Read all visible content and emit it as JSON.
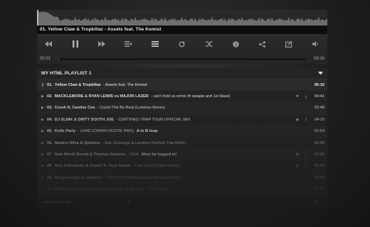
{
  "now_playing": {
    "title": "01. Yellow Claw & Tropkillaz - Assets feat. The Kemist"
  },
  "controls": [
    {
      "name": "rewind-icon"
    },
    {
      "name": "pause-icon"
    },
    {
      "name": "forward-icon"
    },
    {
      "name": "next-track-icon"
    },
    {
      "name": "playlist-icon"
    },
    {
      "name": "repeat-icon"
    },
    {
      "name": "shuffle-icon"
    },
    {
      "name": "info-icon"
    },
    {
      "name": "share-icon"
    },
    {
      "name": "popout-icon"
    },
    {
      "name": "volume-icon"
    }
  ],
  "progress": {
    "current": "00:01",
    "total": "06:16",
    "fraction": 0.003
  },
  "playlist": {
    "name": "MY HTML PLAYLIST 1",
    "tracks": [
      {
        "num": "01.",
        "artist": "Yellow Claw & Tropkillaz",
        "title": "- Assets feat. The Kemist",
        "extra": "",
        "duration": "06:16",
        "active": true,
        "fav": false,
        "dl": false,
        "brightness": 1.0
      },
      {
        "num": "02.",
        "artist": "MACKLEMORE & RYAN LEWIS vs MAJOR LAZER",
        "title": "- can't hold us remix (ft swappi and 1st klase)",
        "extra": "",
        "duration": "04:41",
        "active": false,
        "fav": true,
        "dl": true,
        "brightness": 0.95
      },
      {
        "num": "03.",
        "artist": "Crush ft. Candee Cox",
        "title": "- Could This Be Real (Luminox Remix)",
        "extra": "",
        "duration": "03:49",
        "active": false,
        "fav": false,
        "dl": false,
        "brightness": 0.85
      },
      {
        "num": "04.",
        "artist": "DJ SLiNK & DIRTY SOUTH JOE",
        "title": "- CERTIFIED TRAP TOUR OFFICIAL MIX",
        "extra": "",
        "duration": "04:19",
        "active": false,
        "fav": true,
        "dl": true,
        "brightness": 0.8
      },
      {
        "num": "05.",
        "artist": "Knife Party",
        "title": "- LRAD (CRNKN FESTIE RMX)",
        "extra": "A to B loop",
        "duration": "03:54",
        "active": false,
        "fav": false,
        "dl": false,
        "brightness": 0.78
      },
      {
        "num": "06.",
        "artist": "Sandro Silva & Quintino",
        "title": "- Epic (Carnage & Luminox Festival Trap Refix)",
        "extra": "",
        "duration": "02:09",
        "active": false,
        "fav": false,
        "dl": false,
        "brightness": 0.62
      },
      {
        "num": "07.",
        "artist": "New World Sound & Thomas Newson",
        "title": "- Flute",
        "extra": "Must be logged in!",
        "duration": "02:36",
        "active": false,
        "fav": true,
        "dl": true,
        "brightness": 0.55
      },
      {
        "num": "08.",
        "artist": "Sick Individuals & Axwell ft. Taylr Renee",
        "title": "- I Am (Jacob Plant Remix)",
        "extra": "",
        "duration": "02:41",
        "active": false,
        "fav": true,
        "dl": true,
        "brightness": 0.45
      },
      {
        "num": "09.",
        "artist": "Morgan Page vs. Bearrie",
        "title": "- \"Carry You\" (Morgan Page Bootleg Remix)",
        "extra": "",
        "duration": "03:50",
        "active": false,
        "fav": false,
        "dl": false,
        "brightness": 0.35
      },
      {
        "num": "10.",
        "artist": "Hellosoldier Shandwick & Kolarie ft. La Modeta",
        "title": "- Go Deeper",
        "extra": "",
        "duration": "04:07",
        "active": false,
        "fav": false,
        "dl": false,
        "brightness": 0.25
      }
    ]
  },
  "footer": {
    "search_placeholder": "search in tracks"
  }
}
